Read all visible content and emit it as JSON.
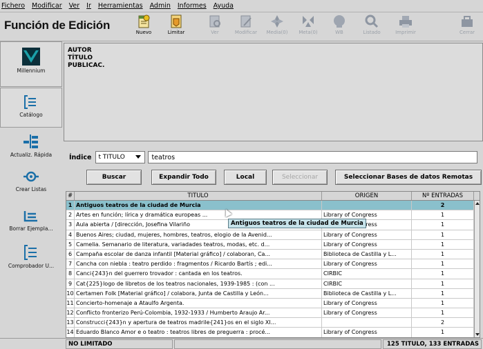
{
  "menu": [
    "Fichero",
    "Modificar",
    "Ver",
    "Ir",
    "Herramientas",
    "Admin",
    "Informes",
    "Ayuda"
  ],
  "app_title": "Función de Edición",
  "toolbar": {
    "nuevo": "Nuevo",
    "limitar": "Limitar",
    "ver": "Ver",
    "modificar": "Modificar",
    "media1": "Media(0)",
    "meta": "Meta(0)",
    "wb": "WB",
    "listado": "Listado",
    "imprimir": "Imprimir",
    "cerrar": "Cerrar"
  },
  "sidebar": {
    "millennium": "Millennium",
    "catalogo": "Catálogo",
    "actualiz": "Actualiz. Rápida",
    "crear_listas": "Crear Listas",
    "borrar": "Borrar Ejempla...",
    "comprobador": "Comprobador U..."
  },
  "info": {
    "autor": "AUTOR",
    "titulo": "TÍTULO",
    "publicac": "PUBLICAC."
  },
  "search": {
    "label": "Índice",
    "index_value": "t TITULO",
    "query": "teatros"
  },
  "buttons": {
    "buscar": "Buscar",
    "expandir": "Expandir Todo",
    "local": "Local",
    "seleccionar": "Seleccionar",
    "remotas": "Seleccionar Bases de datos Remotas"
  },
  "table": {
    "headers": {
      "num": "#",
      "title": "TITULO",
      "origin": "ORIGEN",
      "entries": "Nº ENTRADAS"
    },
    "rows": [
      {
        "num": "1",
        "title": "Antiguos teatros de la ciudad de Murcia",
        "origin": "",
        "entries": "2"
      },
      {
        "num": "2",
        "title": "Artes en función; lírica y dramática europeas ...",
        "origin": "Library of Congress",
        "entries": "1"
      },
      {
        "num": "3",
        "title": "Aula abierta / [dirección, Josefina Vilariño",
        "origin": "Library of Congress",
        "entries": "1"
      },
      {
        "num": "4",
        "title": "Buenos Aires; ciudad, mujeres, hombres, teatros, elogio de la Avenid...",
        "origin": "Library of Congress",
        "entries": "1"
      },
      {
        "num": "5",
        "title": "Camelia. Semanario de literatura, variadades teatros, modas, etc. d...",
        "origin": "Library of Congress",
        "entries": "1"
      },
      {
        "num": "6",
        "title": "Campaña escolar de danza infantil [Material gráfico] / colaboran, Ca...",
        "origin": "Biblioteca de Castilla y L...",
        "entries": "1"
      },
      {
        "num": "7",
        "title": "Cancha con niebla : teatro perdido : fragmentos / Ricardo Bartís ; edi...",
        "origin": "Library of Congress",
        "entries": "1"
      },
      {
        "num": "8",
        "title": "Canci{243}n del guerrero trovador : cantada en los teatros.",
        "origin": "CIRBIC",
        "entries": "1"
      },
      {
        "num": "9",
        "title": "Cat{225}logo de libretos de los teatros nacionales, 1939-1985 : (con ...",
        "origin": "CIRBIC",
        "entries": "1"
      },
      {
        "num": "10",
        "title": "Certamen Folk [Material gráfico] / colabora, Junta de Castilla y León...",
        "origin": "Biblioteca de Castilla y L...",
        "entries": "1"
      },
      {
        "num": "11",
        "title": "Concierto-homenaje a Ataulfo Argenta.",
        "origin": "Library of Congress",
        "entries": "1"
      },
      {
        "num": "12",
        "title": "Conflicto fronterizo Perú-Colombia, 1932-1933 / Humberto Araujo Ar...",
        "origin": "Library of Congress",
        "entries": "1"
      },
      {
        "num": "13",
        "title": "Construcci{243}n y apertura de teatros madrile{241}os en el siglo XI...",
        "origin": "",
        "entries": "2"
      },
      {
        "num": "14",
        "title": "Eduardo Blanco Amor e o teatro : teatros libres de preguerra : procé...",
        "origin": "Library of Congress",
        "entries": "1"
      }
    ]
  },
  "tooltip": "Antiguos teatros de la ciudad de Murcia",
  "status": {
    "left": "NO LIMITADO",
    "right": "125 TITULO, 133 ENTRADAS"
  },
  "colors": {
    "selected_row": "#8ac0cc",
    "tooltip_bg": "#c7e3ea",
    "window_bg": "#d6d6d6"
  }
}
